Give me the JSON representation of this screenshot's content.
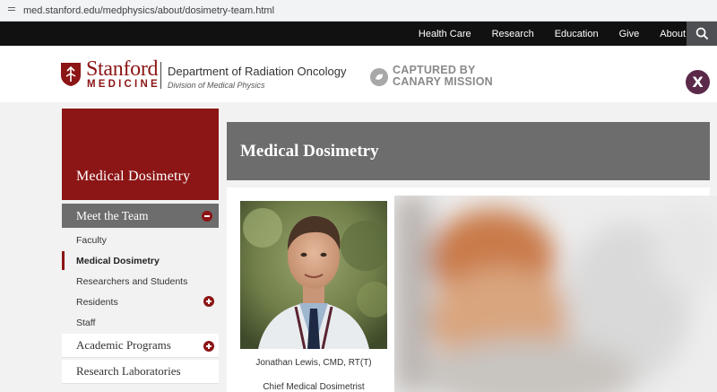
{
  "browser": {
    "url": "med.stanford.edu/medphysics/about/dosimetry-team.html"
  },
  "topnav": {
    "items": [
      "Health Care",
      "Research",
      "Education",
      "Give",
      "About"
    ]
  },
  "header": {
    "logo_stanford": "Stanford",
    "logo_medicine": "MEDICINE",
    "department": "Department of Radiation Oncology",
    "division": "Division of Medical Physics",
    "canary_line1": "CAPTURED BY",
    "canary_line2": "CANARY MISSION",
    "x_label": "X"
  },
  "sidebar": {
    "hero_title": "Medical Dosimetry",
    "section_title": "Meet the Team",
    "items": [
      {
        "label": "Faculty"
      },
      {
        "label": "Medical Dosimetry"
      },
      {
        "label": "Researchers and Students"
      },
      {
        "label": "Residents"
      },
      {
        "label": "Staff"
      }
    ],
    "boxes": [
      "Academic Programs",
      "Research Laboratories"
    ]
  },
  "main": {
    "title": "Medical Dosimetry",
    "person_name": "Jonathan Lewis, CMD, RT(T)",
    "person_title": "Chief Medical Dosimetrist"
  },
  "colors": {
    "cardinal": "#8c1515",
    "banner_gray": "#6d6d6d",
    "nav_black": "#111111"
  }
}
